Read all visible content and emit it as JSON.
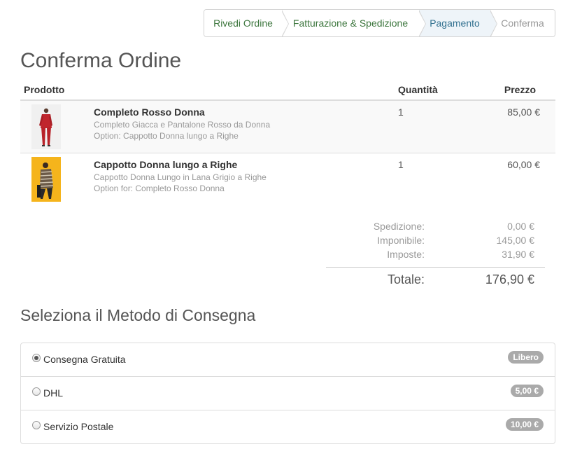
{
  "steps": [
    {
      "label": "Rivedi Ordine",
      "state": "done"
    },
    {
      "label": "Fatturazione & Spedizione",
      "state": "done"
    },
    {
      "label": "Pagamento",
      "state": "active"
    },
    {
      "label": "Conferma",
      "state": "todo"
    }
  ],
  "page_title": "Conferma Ordine",
  "table": {
    "headers": {
      "product": "Prodotto",
      "quantity": "Quantità",
      "price": "Prezzo"
    },
    "rows": [
      {
        "name": "Completo Rosso Donna",
        "description": "Completo Giacca e Pantalone Rosso da Donna",
        "option": "Option: Cappotto Donna lungo a Righe",
        "quantity": "1",
        "price": "85,00 €"
      },
      {
        "name": "Cappotto Donna lungo a Righe",
        "description": "Cappotto Donna Lungo in Lana Grigio a Righe",
        "option": "Option for: Completo Rosso Donna",
        "quantity": "1",
        "price": "60,00 €"
      }
    ]
  },
  "totals": {
    "shipping_label": "Spedizione:",
    "shipping_value": "0,00 €",
    "subtotal_label": "Imponibile:",
    "subtotal_value": "145,00 €",
    "tax_label": "Imposte:",
    "tax_value": "31,90 €",
    "total_label": "Totale:",
    "total_value": "176,90 €"
  },
  "delivery": {
    "title": "Seleziona il Metodo di Consegna",
    "options": [
      {
        "label": "Consegna Gratuita",
        "badge": "Libero",
        "selected": true
      },
      {
        "label": "DHL",
        "badge": "5,00 €",
        "selected": false
      },
      {
        "label": "Servizio Postale",
        "badge": "10,00 €",
        "selected": false
      }
    ]
  },
  "colors": {
    "step_done": "#3c763d",
    "step_active": "#31708f",
    "step_todo": "#999999",
    "badge_bg": "#aaaaaa"
  }
}
